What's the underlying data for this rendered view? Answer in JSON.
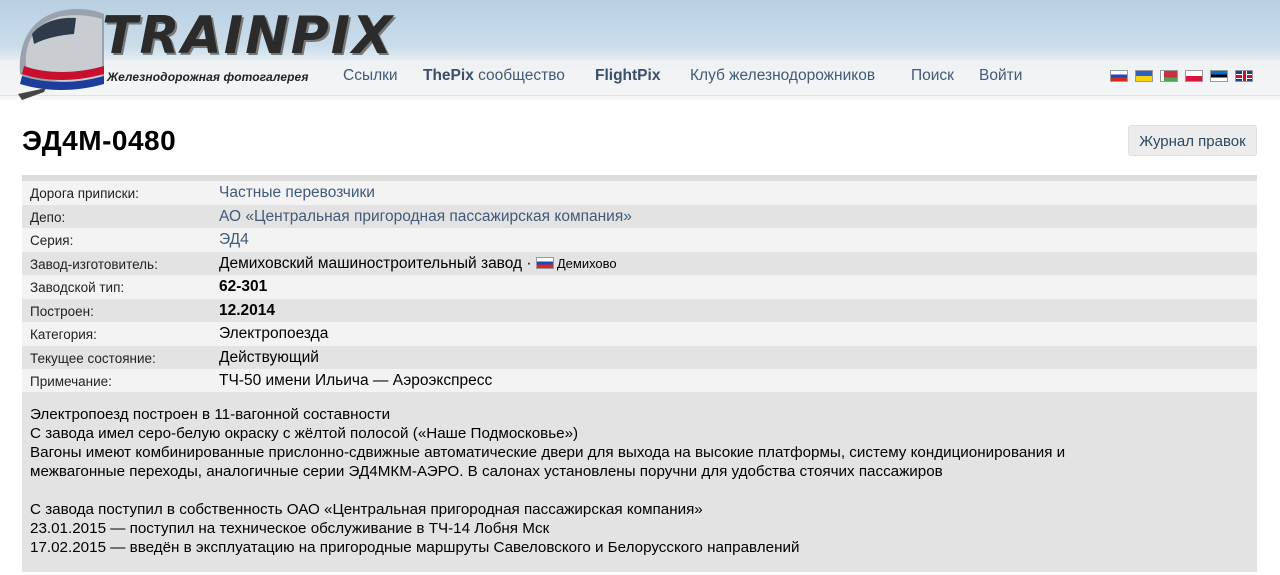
{
  "header": {
    "logo_text": "TRAINPIX",
    "logo_subtitle": "Железнодорожная фотогалерея",
    "nav": {
      "links": "Ссылки",
      "thepix_bold": "ThePix",
      "thepix_rest": " сообщество",
      "flightpix": "FlightPix",
      "club": "Клуб железнодорожников",
      "search": "Поиск",
      "login": "Войти"
    },
    "flags": [
      "russia-flag-icon",
      "ukraine-flag-icon",
      "belarus-flag-icon",
      "poland-flag-icon",
      "estonia-flag-icon",
      "uk-flag-icon"
    ]
  },
  "page": {
    "title": "ЭД4М-0480",
    "journal_button": "Журнал правок"
  },
  "info": {
    "road_label": "Дорога приписки:",
    "road_value": "Частные перевозчики",
    "depot_label": "Депо:",
    "depot_value": "АО «Центральная пригородная пассажирская компания»",
    "series_label": "Серия:",
    "series_value": "ЭД4",
    "factory_label": "Завод-изготовитель:",
    "factory_value": "Демиховский машиностроительный завод · ",
    "factory_city": "Демихово",
    "type_label": "Заводской тип:",
    "type_value": "62-301",
    "built_label": "Построен:",
    "built_value": "12.2014",
    "category_label": "Категория:",
    "category_value": "Электропоезда",
    "state_label": "Текущее состояние:",
    "state_value": "Действующий",
    "note_label": "Примечание:",
    "note_value": "ТЧ-50 имени Ильича — Аэроэкспресс"
  },
  "notes": {
    "lines1": [
      "Электропоезд построен в 11-вагонной составности",
      "С завода имел серо-белую окраску с жёлтой полосой («Наше Подмосковье»)",
      "Вагоны имеют комбинированные прислонно-сдвижные автоматические двери для выхода на высокие платформы, систему кондиционирования и",
      "межвагонные переходы, аналогичные серии ЭД4МКМ-АЭРО. В салонах установлены поручни для удобства стоячих пассажиров"
    ],
    "lines2": [
      "С завода поступил в собственность ОАО «Центральная пригородная пассажирская компания»",
      "23.01.2015 — поступил на техническое обслуживание в ТЧ-14 Лобня Мск",
      "17.02.2015 — введён в эксплуатацию на пригородные маршруты Савеловского и Белорусского направлений"
    ]
  }
}
